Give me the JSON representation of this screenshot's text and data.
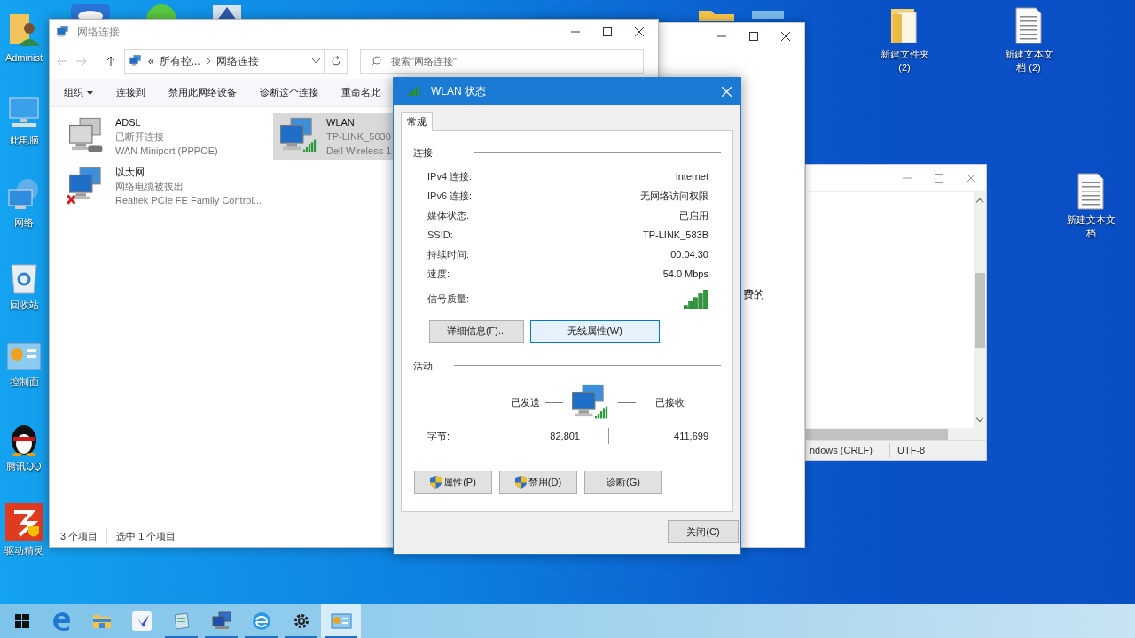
{
  "desktop_left": [
    {
      "label": "Administ",
      "kind": "user"
    },
    {
      "label": "此电脑",
      "kind": "computer"
    },
    {
      "label": "网络",
      "kind": "network"
    },
    {
      "label": "回收站",
      "kind": "recycle"
    },
    {
      "label": "控制面",
      "kind": "control"
    },
    {
      "label": "腾讯QQ",
      "kind": "penguin"
    },
    {
      "label": "驱动精灵",
      "kind": "driver"
    }
  ],
  "desktop_right": [
    {
      "label": "新建文件夹 (2)",
      "kind": "folder"
    },
    {
      "label": "新建文本文档 (2)",
      "kind": "document"
    },
    {
      "label": "新建文本文档",
      "kind": "document"
    }
  ],
  "back_window": {
    "fragment": "费的"
  },
  "notepad": {
    "status_bar": [
      "ndows (CRLF)",
      "UTF-8"
    ]
  },
  "explorer": {
    "title": "网络连接",
    "address": {
      "prefix": "«",
      "parts": [
        "所有控...",
        "网络连接"
      ]
    },
    "search": {
      "placeholder": "搜索\"网络连接\""
    },
    "toolbar": [
      {
        "label": "组织",
        "dropdown": true
      },
      {
        "label": "连接到",
        "dropdown": false
      },
      {
        "label": "禁用此网络设备",
        "dropdown": false
      },
      {
        "label": "诊断这个连接",
        "dropdown": false
      },
      {
        "label": "重命名此",
        "dropdown": false
      }
    ],
    "connections": [
      {
        "name": "ADSL",
        "status": "已断开连接",
        "device": "WAN Miniport (PPPOE)",
        "kind": "dialup",
        "selected": false
      },
      {
        "name": "WLAN",
        "status": "TP-LINK_5030",
        "device": "Dell Wireless 1",
        "kind": "wireless",
        "selected": true
      },
      {
        "name": "以太网",
        "status": "网络电缆被拔出",
        "device": "Realtek PCIe FE Family Control...",
        "kind": "unplugged",
        "selected": false
      }
    ],
    "status_bar": [
      "3 个项目",
      "选中 1 个项目"
    ]
  },
  "dialog": {
    "title": "WLAN 状态",
    "tabs": [
      {
        "label": "常规",
        "selected": true
      }
    ],
    "connection_heading": "连接",
    "rows": [
      {
        "label": "IPv4 连接:",
        "value": "Internet",
        "kind": "text"
      },
      {
        "label": "IPv6 连接:",
        "value": "无网络访问权限",
        "kind": "text"
      },
      {
        "label": "媒体状态:",
        "value": "已启用",
        "kind": "text"
      },
      {
        "label": "SSID:",
        "value": "TP-LINK_583B",
        "kind": "text"
      },
      {
        "label": "持续时间:",
        "value": "00:04:30",
        "kind": "text"
      },
      {
        "label": "速度:",
        "value": "54.0 Mbps",
        "kind": "text"
      },
      {
        "label": "信号质量:",
        "kind": "signal"
      }
    ],
    "detail_buttons": [
      {
        "label": "详细信息(F)...",
        "focused": false
      },
      {
        "label": "无线属性(W)",
        "focused": true
      }
    ],
    "activity_heading": "活动",
    "sent_label": "已发送",
    "received_label": "已接收",
    "bytes_label": "字节:",
    "bytes_sent": "82,801",
    "bytes_received": "411,699",
    "action_buttons": [
      {
        "label": "属性(P)",
        "shield": true
      },
      {
        "label": "禁用(D)",
        "shield": true
      },
      {
        "label": "诊断(G)",
        "shield": false
      }
    ],
    "close_button": "关闭(C)"
  },
  "taskbar": [
    {
      "kind": "start",
      "running": false,
      "selected": false
    },
    {
      "kind": "edge",
      "running": false,
      "selected": false
    },
    {
      "kind": "folder",
      "running": false,
      "selected": false
    },
    {
      "kind": "bird",
      "running": false,
      "selected": false
    },
    {
      "kind": "notepad",
      "running": true,
      "selected": false
    },
    {
      "kind": "network",
      "running": true,
      "selected": false
    },
    {
      "kind": "ie",
      "running": true,
      "selected": false
    },
    {
      "kind": "settings",
      "running": true,
      "selected": false
    },
    {
      "kind": "control",
      "running": true,
      "selected": true
    }
  ]
}
